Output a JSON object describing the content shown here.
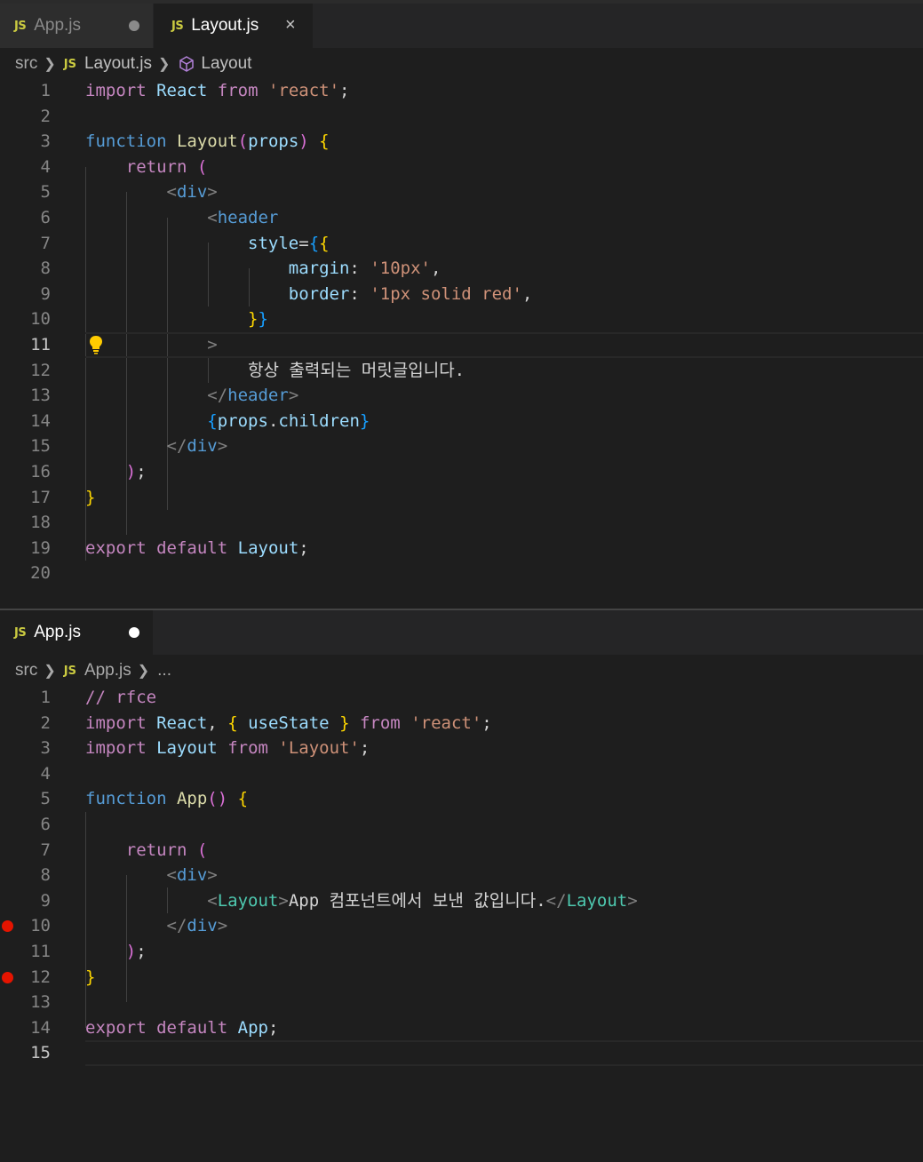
{
  "top_group": {
    "tabs": [
      {
        "label": "App.js",
        "icon_label": "JS",
        "state": "inactive",
        "modified": true
      },
      {
        "label": "Layout.js",
        "icon_label": "JS",
        "state": "active",
        "modified": false,
        "close_icon": "×"
      }
    ],
    "breadcrumb": {
      "folder": "src",
      "file_icon": "JS",
      "file": "Layout.js",
      "symbol_icon": "cube-icon",
      "symbol": "Layout"
    },
    "current_line": 11,
    "lines": [
      {
        "n": "1"
      },
      {
        "n": "2"
      },
      {
        "n": "3"
      },
      {
        "n": "4"
      },
      {
        "n": "5"
      },
      {
        "n": "6"
      },
      {
        "n": "7"
      },
      {
        "n": "8"
      },
      {
        "n": "9"
      },
      {
        "n": "10"
      },
      {
        "n": "11"
      },
      {
        "n": "12"
      },
      {
        "n": "13"
      },
      {
        "n": "14"
      },
      {
        "n": "15"
      },
      {
        "n": "16"
      },
      {
        "n": "17"
      },
      {
        "n": "18"
      },
      {
        "n": "19"
      },
      {
        "n": "20"
      }
    ],
    "text": {
      "l12": "항상 출력되는 머릿글입니다."
    }
  },
  "bottom_group": {
    "tabs": [
      {
        "label": "App.js",
        "icon_label": "JS",
        "state": "active",
        "modified": true
      }
    ],
    "breadcrumb": {
      "folder": "src",
      "file_icon": "JS",
      "file": "App.js",
      "more": "..."
    },
    "current_line": 15,
    "breakpoints": [
      10,
      12
    ],
    "lines": [
      {
        "n": "1"
      },
      {
        "n": "2"
      },
      {
        "n": "3"
      },
      {
        "n": "4"
      },
      {
        "n": "5"
      },
      {
        "n": "6"
      },
      {
        "n": "7"
      },
      {
        "n": "8"
      },
      {
        "n": "9"
      },
      {
        "n": "10"
      },
      {
        "n": "11"
      },
      {
        "n": "12"
      },
      {
        "n": "13"
      },
      {
        "n": "14"
      },
      {
        "n": "15"
      }
    ],
    "text": {
      "l9": "App 컴포넌트에서 보낸 값입니다."
    }
  },
  "colors": {
    "background": "#1e1e1e",
    "keyword": "#569cd6",
    "control": "#c586c0",
    "string": "#ce9178",
    "function": "#dcdcaa",
    "variable": "#9cdcfe",
    "component": "#4ec9b0",
    "breakpoint": "#e51400",
    "js_icon": "#cbcb41"
  }
}
